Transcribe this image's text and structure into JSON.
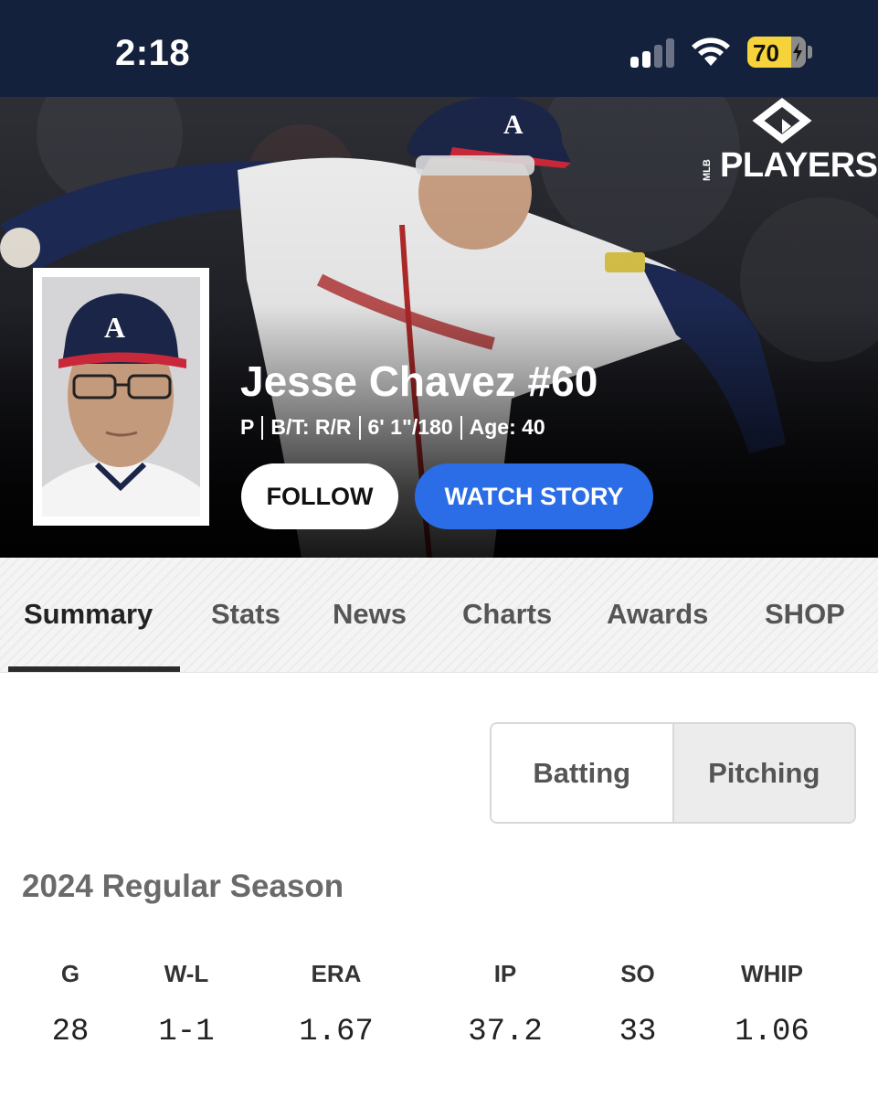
{
  "status_bar": {
    "time": "2:18",
    "battery_percent": "70",
    "signal_bars_active": 2,
    "signal_bars_total": 4,
    "wifi_icon": "wifi-icon",
    "charging_icon": "bolt-icon"
  },
  "hero": {
    "logo_main": "PLAYERS",
    "logo_small": "MLB",
    "player_name": "Jesse Chavez #60",
    "meta": {
      "position": "P",
      "bats_throws": "B/T: R/R",
      "height_weight": "6' 1\"/180",
      "age": "Age: 40"
    },
    "follow_label": "FOLLOW",
    "watch_label": "WATCH STORY"
  },
  "tabs": [
    {
      "label": "Summary",
      "active": true
    },
    {
      "label": "Stats",
      "active": false
    },
    {
      "label": "News",
      "active": false
    },
    {
      "label": "Charts",
      "active": false
    },
    {
      "label": "Awards",
      "active": false
    },
    {
      "label": "SHOP",
      "active": false
    }
  ],
  "segment": {
    "batting_label": "Batting",
    "pitching_label": "Pitching",
    "selected": "Pitching"
  },
  "season": {
    "title": "2024 Regular Season",
    "headers": [
      "G",
      "W-L",
      "ERA",
      "IP",
      "SO",
      "WHIP"
    ],
    "values": [
      "28",
      "1-1",
      "1.67",
      "37.2",
      "33",
      "1.06"
    ]
  },
  "colors": {
    "status_bar_bg": "#14213d",
    "accent_blue": "#2a6de6",
    "battery_yellow": "#f6d33a"
  }
}
